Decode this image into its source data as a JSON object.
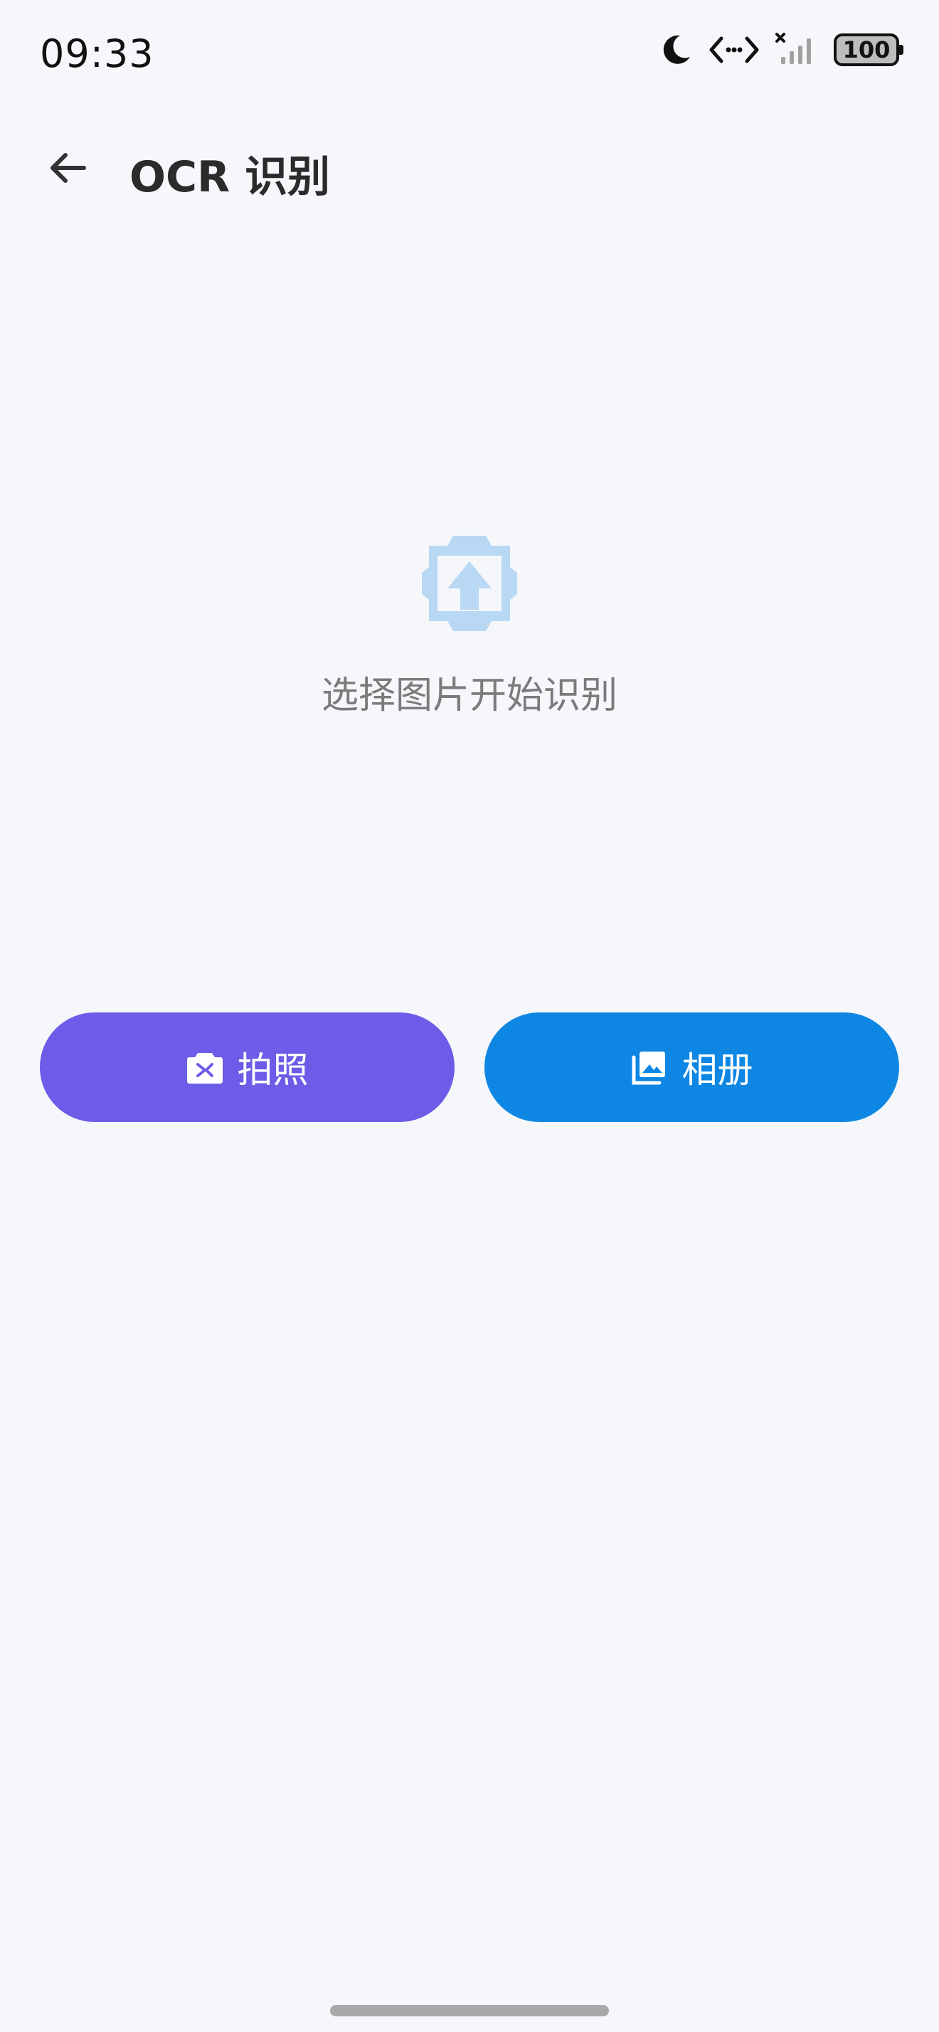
{
  "status_bar": {
    "time": "09:33",
    "battery_level": "100"
  },
  "header": {
    "title": "OCR 识别"
  },
  "empty_state": {
    "message": "选择图片开始识别",
    "icon": "image-upload-icon",
    "icon_color": "#b9d8f4"
  },
  "actions": {
    "camera": {
      "label": "拍照",
      "icon": "camera-icon",
      "color": "#6c5ce7"
    },
    "album": {
      "label": "相册",
      "icon": "gallery-icon",
      "color": "#0e86e3"
    }
  },
  "colors": {
    "background": "#f5f7fb"
  }
}
